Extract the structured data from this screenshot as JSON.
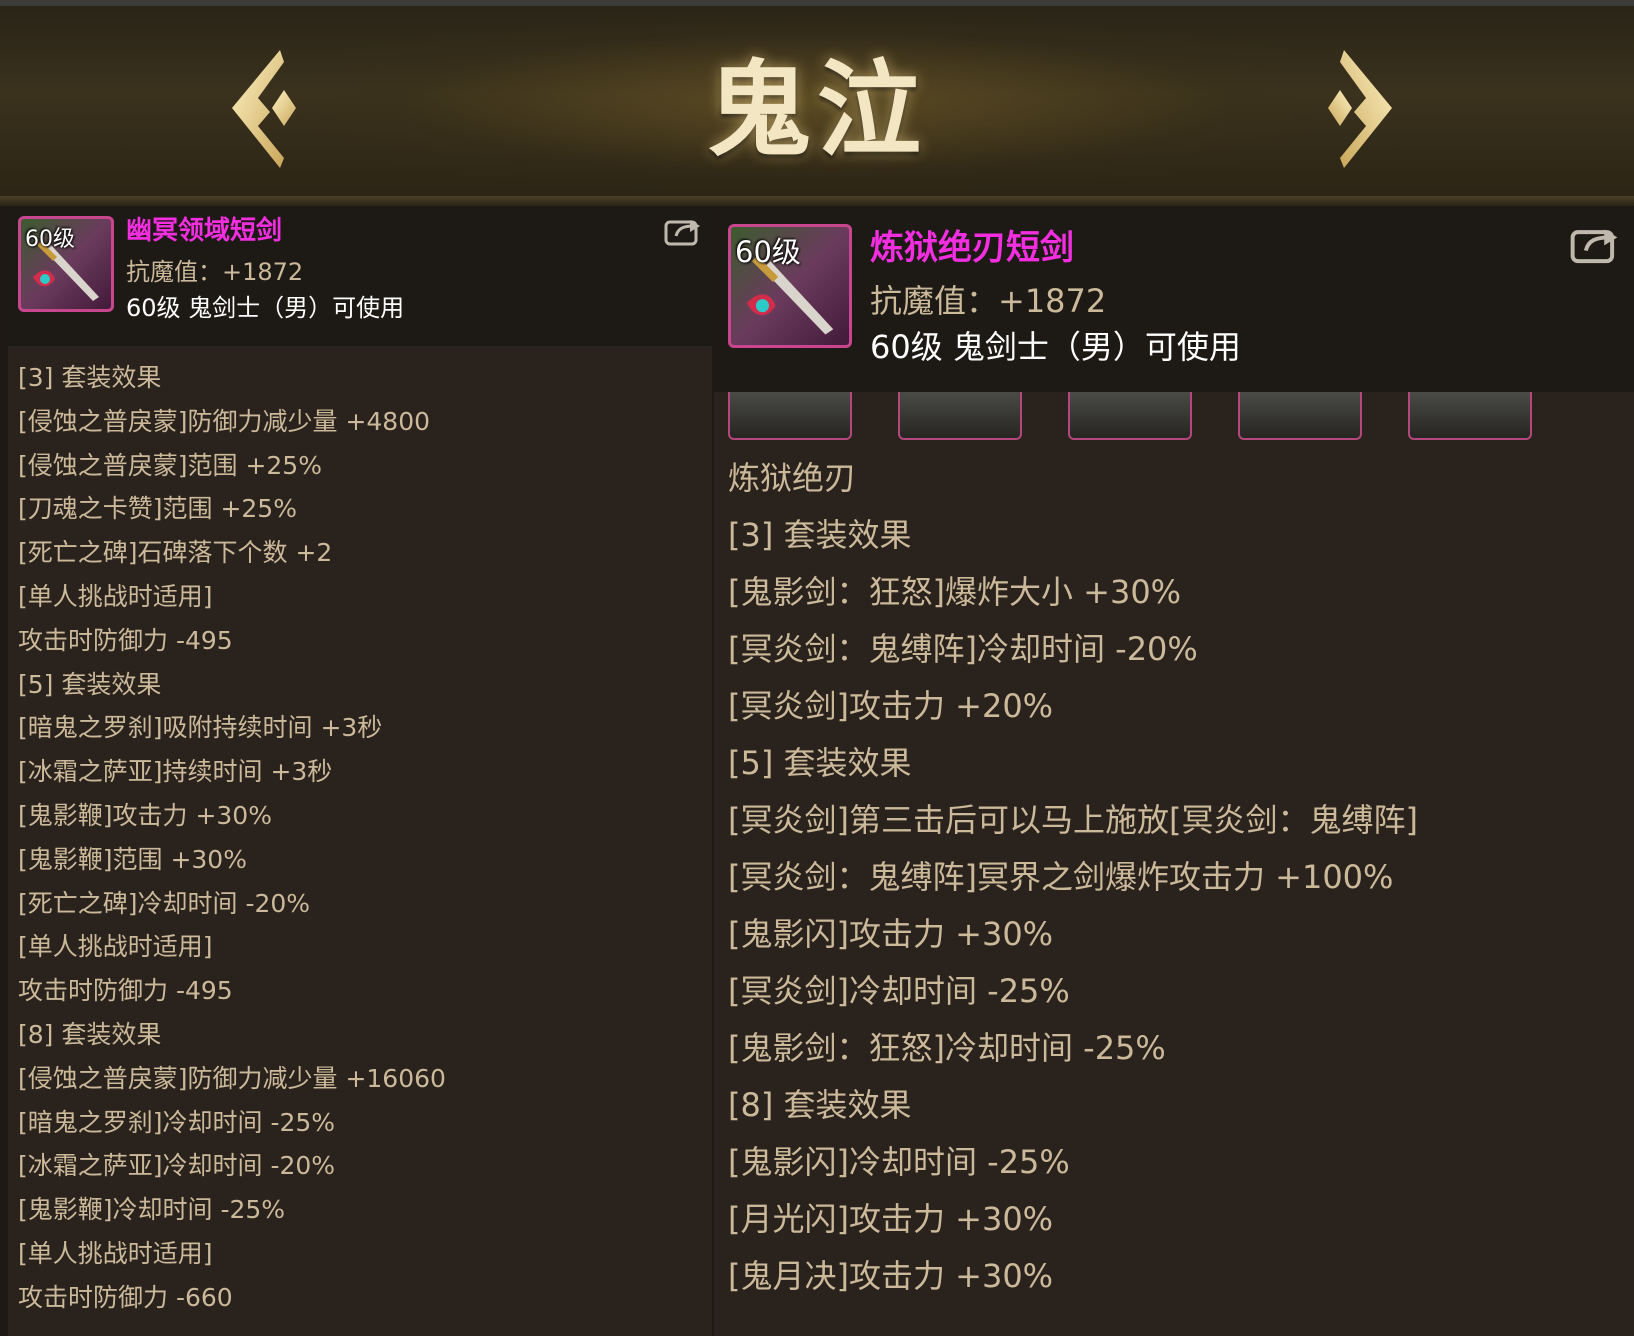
{
  "header": {
    "title": "鬼泣"
  },
  "left_item": {
    "level": "60级",
    "name": "幽冥领域短剑",
    "stat": "抗魔值：+1872",
    "usable": "60级 鬼剑士（男）可使用",
    "effects": [
      "[3] 套装效果",
      "[侵蚀之普戾蒙]防御力减少量 +4800",
      "[侵蚀之普戾蒙]范围 +25%",
      "[刀魂之卡赞]范围 +25%",
      "[死亡之碑]石碑落下个数 +2",
      "[单人挑战时适用]",
      "攻击时防御力 -495",
      "[5] 套装效果",
      "[暗鬼之罗刹]吸附持续时间 +3秒",
      "[冰霜之萨亚]持续时间 +3秒",
      "[鬼影鞭]攻击力 +30%",
      "[鬼影鞭]范围 +30%",
      "[死亡之碑]冷却时间 -20%",
      "[单人挑战时适用]",
      "攻击时防御力 -495",
      "[8] 套装效果",
      "[侵蚀之普戾蒙]防御力减少量 +16060",
      "[暗鬼之罗刹]冷却时间 -25%",
      "[冰霜之萨亚]冷却时间 -20%",
      "[鬼影鞭]冷却时间 -25%",
      "[单人挑战时适用]",
      "攻击时防御力 -660"
    ]
  },
  "right_item": {
    "level": "60级",
    "name": "炼狱绝刃短剑",
    "stat": "抗魔值：+1872",
    "usable": "60级 鬼剑士（男）可使用",
    "set_name": "炼狱绝刃",
    "effects": [
      "[3] 套装效果",
      "[鬼影剑：狂怒]爆炸大小 +30%",
      "[冥炎剑：鬼缚阵]冷却时间 -20%",
      "[冥炎剑]攻击力 +20%",
      "[5] 套装效果",
      "[冥炎剑]第三击后可以马上施放[冥炎剑：鬼缚阵]",
      "[冥炎剑：鬼缚阵]冥界之剑爆炸攻击力 +100%",
      "[鬼影闪]攻击力 +30%",
      "[冥炎剑]冷却时间 -25%",
      "[鬼影剑：狂怒]冷却时间 -25%",
      "[8] 套装效果",
      "[鬼影闪]冷却时间 -25%",
      "[月光闪]攻击力 +30%",
      "[鬼月决]攻击力 +30%"
    ]
  },
  "colors": {
    "name": "#f22ee0",
    "text": "#cbb99a",
    "title": "#f3e6c3",
    "slot_border": "#b4477e"
  },
  "icons": [
    "arrow-left-icon",
    "arrow-right-icon",
    "share-icon",
    "sword-icon"
  ]
}
